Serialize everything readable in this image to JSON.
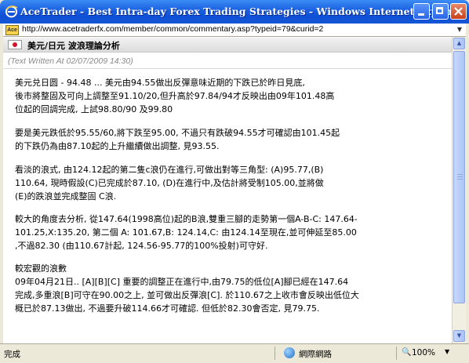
{
  "window": {
    "title": "AceTrader - Best Intra-day Forex Trading Strategies - Windows Internet Explorer",
    "url": "http://www.acetraderfx.com/member/common/commentary.asp?typeid=79&curid=2",
    "site_icon_text": "Ace"
  },
  "header": {
    "title": "美元/日元 波浪理論分析",
    "written": "(Text Written At 02/07/2009 14:30)"
  },
  "paragraphs": [
    [
      "美元兑日圆 - 94.48 ... 美元由94.55做出反彈意味近期的下跌已於昨日見底,",
      "後市將整固及可向上調整至91.10/20,但升高於97.84/94才反映出由09年101.48高",
      "位起的回調完成, 上試98.80/90 及99.80"
    ],
    [
      "要是美元跌低於95.55/60,將下跌至95.00, 不過只有跌破94.55才可確認由101.45起",
      "的下跌仍為由87.10起的上升繼續做出調整, 見93.55."
    ],
    [
      "看淡的浪式, 由124.12起的第二隻c浪仍在進行,可做出對等三角型: (A)95.77,(B)",
      "110.64, 現時假設(C)已完成於87.10, (D)在進行中,及估計將受制105.00,並將做",
      "(E)的跌浪並完成整固 C浪."
    ],
    [
      "較大的角度去分析, 從147.64(1998高位)起的B浪,雙重三腳的走勢第一個A-B-C: 147.64-",
      "101.25,X:135.20, 第二個 A: 101.67,B: 124.14,C: 由124.14至現在,並可伸延至85.00",
      ",不過82.30 (由110.67計起, 124.56-95.77的100%投射)可守好."
    ],
    [
      "較宏觀的浪數",
      "09年04月21日.. [A][B][C] 重要的調整正在進行中,由79.75的低位[A]腳已經在147.64",
      "完成,多重浪[B]可守在90.00之上, 並可做出反彈浪[C]. 於110.67之上收市會反映出低位大",
      "概已於87.13做出, 不過要升破114.66才可確認. 但低於82.30會否定, 見79.75."
    ]
  ],
  "status": {
    "text": "完成",
    "zone": "網際網路",
    "zoom": "100%"
  },
  "colors": {
    "titlebar": "#1a5fe0",
    "flag_red": "#d0142a"
  },
  "icons": [
    "ie-logo-icon",
    "minimize-icon",
    "maximize-icon",
    "close-icon",
    "japan-flag-icon",
    "globe-icon",
    "zoom-icon"
  ]
}
